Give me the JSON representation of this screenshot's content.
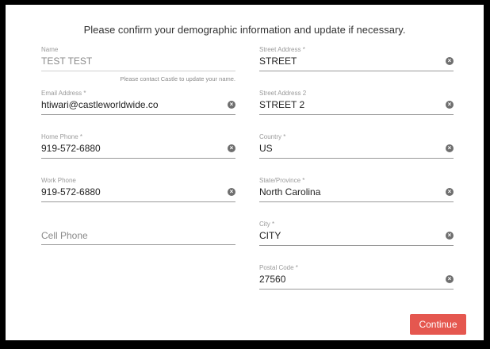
{
  "title": "Please confirm your demographic information and update if necessary.",
  "left_fields": [
    {
      "label": "Name",
      "value": "TEST  TEST",
      "hint": "Please contact Castle to update your name."
    },
    {
      "label": "Email Address *",
      "value": "htiwari@castleworldwide.co"
    },
    {
      "label": "Home Phone *",
      "value": "919-572-6880"
    },
    {
      "label": "Work Phone",
      "value": "919-572-6880"
    },
    {
      "placeholder": "Cell Phone"
    }
  ],
  "right_fields": [
    {
      "label": "Street Address *",
      "value": "STREET"
    },
    {
      "label": "Street Address 2",
      "value": "STREET 2"
    },
    {
      "label": "Country *",
      "value": "US"
    },
    {
      "label": "State/Province *",
      "value": "North Carolina"
    },
    {
      "label": "City *",
      "value": "CITY"
    },
    {
      "label": "Postal Code *",
      "value": "27560"
    }
  ],
  "clear_icon": "x-circle-icon",
  "continue_label": "Continue",
  "colors": {
    "accent": "#e5574f",
    "frame": "#000000"
  }
}
